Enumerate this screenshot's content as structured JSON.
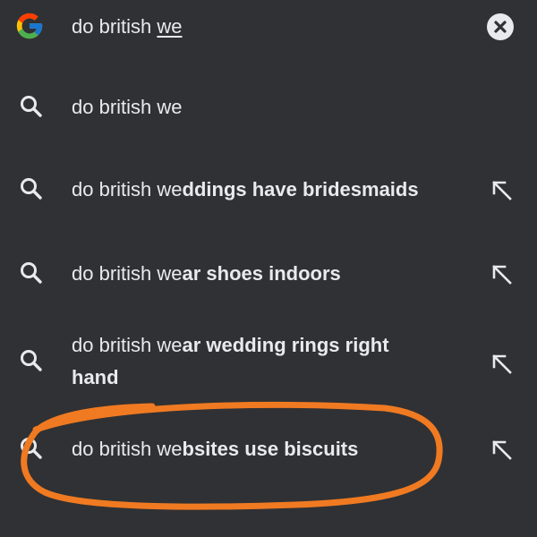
{
  "search_bar": {
    "logo_icon": "google-g-icon",
    "query_prefix": "do british ",
    "query_typed": "we",
    "clear_icon": "close-circle-icon"
  },
  "suggestions": [
    {
      "prefix": "do british we",
      "completion": "",
      "line2": "",
      "has_fill_arrow": false
    },
    {
      "prefix": "do british we",
      "completion": "ddings have bridesmaids",
      "line2": "",
      "has_fill_arrow": true
    },
    {
      "prefix": "do british we",
      "completion": "ar shoes indoors",
      "line2": "",
      "has_fill_arrow": true
    },
    {
      "prefix": "do british we",
      "completion": "ar wedding rings right",
      "line2": "hand",
      "has_fill_arrow": true
    },
    {
      "prefix": "do british we",
      "completion": "bsites use biscuits",
      "line2": "",
      "has_fill_arrow": true
    }
  ],
  "icons": {
    "suggestion": "search-icon",
    "fill_query": "north-west-arrow-icon"
  },
  "colors": {
    "background": "#303134",
    "text": "#e8eaed",
    "annotation": "#f07a21"
  }
}
